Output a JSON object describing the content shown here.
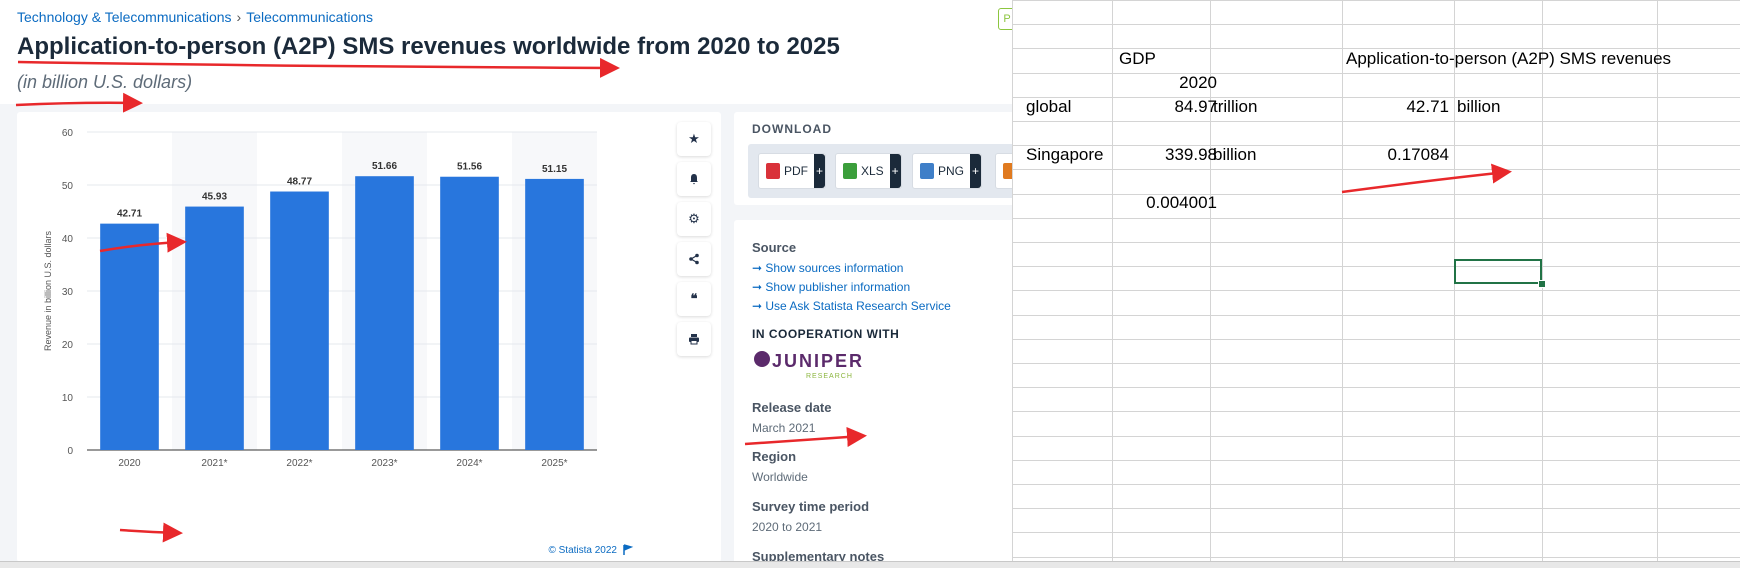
{
  "breadcrumb": {
    "items": [
      "Technology & Telecommunications",
      "Telecommunications"
    ],
    "separator": "›"
  },
  "page": {
    "title": "Application-to-person (A2P) SMS revenues worldwide from 2020 to 2025",
    "subtitle": "(in billion U.S. dollars)",
    "premium_tag": "P"
  },
  "chart_data": {
    "type": "bar",
    "categories": [
      "2020",
      "2021*",
      "2022*",
      "2023*",
      "2024*",
      "2025*"
    ],
    "values": [
      42.71,
      45.93,
      48.77,
      51.66,
      51.56,
      51.15
    ],
    "ylabel": "Revenue in billion U.S. dollars",
    "ylim": [
      0,
      60
    ],
    "yticks": [
      0,
      10,
      20,
      30,
      40,
      50,
      60
    ],
    "grid": true,
    "bar_color": "#2876dd",
    "credit": "© Statista 2022"
  },
  "toolbar": {
    "icons": [
      "star-icon",
      "bell-icon",
      "gear-icon",
      "share-icon",
      "quote-icon",
      "print-icon"
    ]
  },
  "download": {
    "title": "DOWNLOAD",
    "buttons": [
      {
        "label": "PDF",
        "color": "#d9323a"
      },
      {
        "label": "XLS",
        "color": "#3b9e3b"
      },
      {
        "label": "PNG",
        "color": "#3f7fc8"
      },
      {
        "label": "",
        "color": "#e07a1f"
      }
    ]
  },
  "info": {
    "source_heading": "Source",
    "links": [
      "Show sources information",
      "Show publisher information",
      "Use Ask Statista Research Service"
    ],
    "coop_heading": "IN COOPERATION WITH",
    "partner_logo_text": "JUNIPER",
    "partner_logo_sub": "RESEARCH",
    "release_heading": "Release date",
    "release_value": "March 2021",
    "region_heading": "Region",
    "region_value": "Worldwide",
    "survey_heading": "Survey time period",
    "survey_value": "2020 to 2021",
    "supp_heading": "Supplementary notes"
  },
  "sheet": {
    "col_b_header": "GDP",
    "col_e_header": "Application-to-person (A2P) SMS revenues",
    "year": "2020",
    "row_global": {
      "label": "global",
      "gdp": "84.97",
      "gdp_unit": "trillion",
      "rev": "42.71",
      "rev_unit": "billion"
    },
    "row_singapore": {
      "label": "Singapore",
      "gdp": "339.98",
      "gdp_unit": "billion",
      "rev": "0.17084"
    },
    "ratio": "0.004001"
  },
  "colors": {
    "accent_link": "#0b6bc2",
    "annotation_arrow": "#e8282b",
    "sheet_grid": "#d4d4d4",
    "sheet_selection": "#217346"
  }
}
